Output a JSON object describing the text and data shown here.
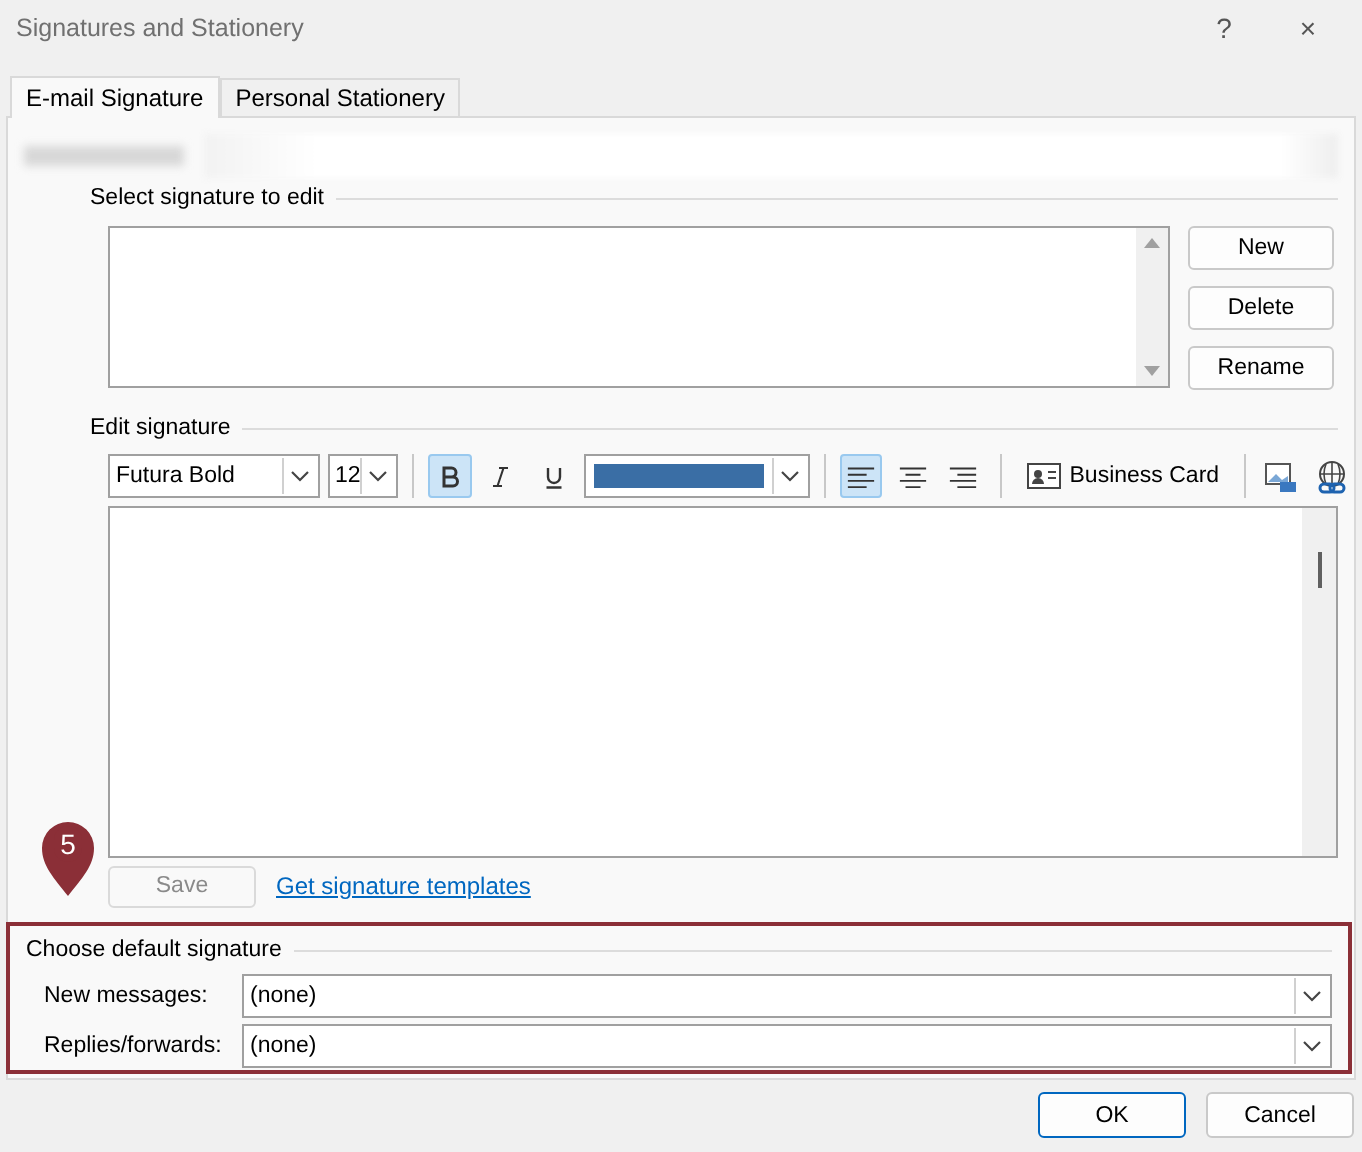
{
  "window": {
    "title": "Signatures and Stationery",
    "help": "?",
    "close": "×"
  },
  "tabs": [
    {
      "label": "E-mail Signature",
      "selected": true
    },
    {
      "label": "Personal Stationery",
      "selected": false
    }
  ],
  "select_section": {
    "label": "Select signature to edit",
    "buttons": [
      {
        "label": "New",
        "disabled": false
      },
      {
        "label": "Delete",
        "disabled": false
      },
      {
        "label": "Rename",
        "disabled": false
      }
    ]
  },
  "edit_section": {
    "label": "Edit signature",
    "toolbar": {
      "font": "Futura Bold",
      "size": "12",
      "bold": true,
      "italic": false,
      "underline": false,
      "color": "#3a6ea5",
      "align_left": true,
      "align_center": false,
      "align_right": false,
      "business_card": {
        "label": "Business Card"
      }
    },
    "save": {
      "label": "Save",
      "disabled": true
    },
    "templates_link": "Get signature templates"
  },
  "callout": {
    "number": "5"
  },
  "default_section": {
    "label": "Choose default signature",
    "rows": [
      {
        "label": "New messages:",
        "value": "(none)"
      },
      {
        "label": "Replies/forwards:",
        "value": "(none)"
      }
    ]
  },
  "buttons": [
    {
      "label": "OK",
      "default": true
    },
    {
      "label": "Cancel",
      "default": false
    }
  ]
}
